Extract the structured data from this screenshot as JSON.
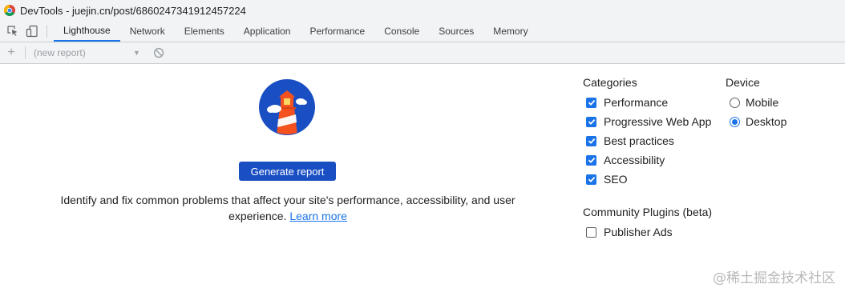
{
  "window": {
    "title": "DevTools - juejin.cn/post/6860247341912457224"
  },
  "tabs": [
    {
      "label": "Lighthouse",
      "active": true
    },
    {
      "label": "Network"
    },
    {
      "label": "Elements"
    },
    {
      "label": "Application"
    },
    {
      "label": "Performance"
    },
    {
      "label": "Console"
    },
    {
      "label": "Sources"
    },
    {
      "label": "Memory"
    }
  ],
  "toolbar": {
    "report_select": "(new report)"
  },
  "main": {
    "generate_label": "Generate report",
    "description": "Identify and fix common problems that affect your site's performance, accessibility, and user experience.",
    "learn_more": "Learn more"
  },
  "categories": {
    "title": "Categories",
    "items": [
      {
        "label": "Performance",
        "checked": true
      },
      {
        "label": "Progressive Web App",
        "checked": true
      },
      {
        "label": "Best practices",
        "checked": true
      },
      {
        "label": "Accessibility",
        "checked": true
      },
      {
        "label": "SEO",
        "checked": true
      }
    ]
  },
  "device": {
    "title": "Device",
    "options": [
      {
        "label": "Mobile",
        "selected": false
      },
      {
        "label": "Desktop",
        "selected": true
      }
    ]
  },
  "plugins": {
    "title": "Community Plugins (beta)",
    "items": [
      {
        "label": "Publisher Ads",
        "checked": false
      }
    ]
  },
  "watermark": "@稀土掘金技术社区",
  "colors": {
    "accent": "#1a73e8",
    "button": "#1a4fc4",
    "logo_bg": "#1a4fc4",
    "lighthouse_red": "#f4511e"
  }
}
